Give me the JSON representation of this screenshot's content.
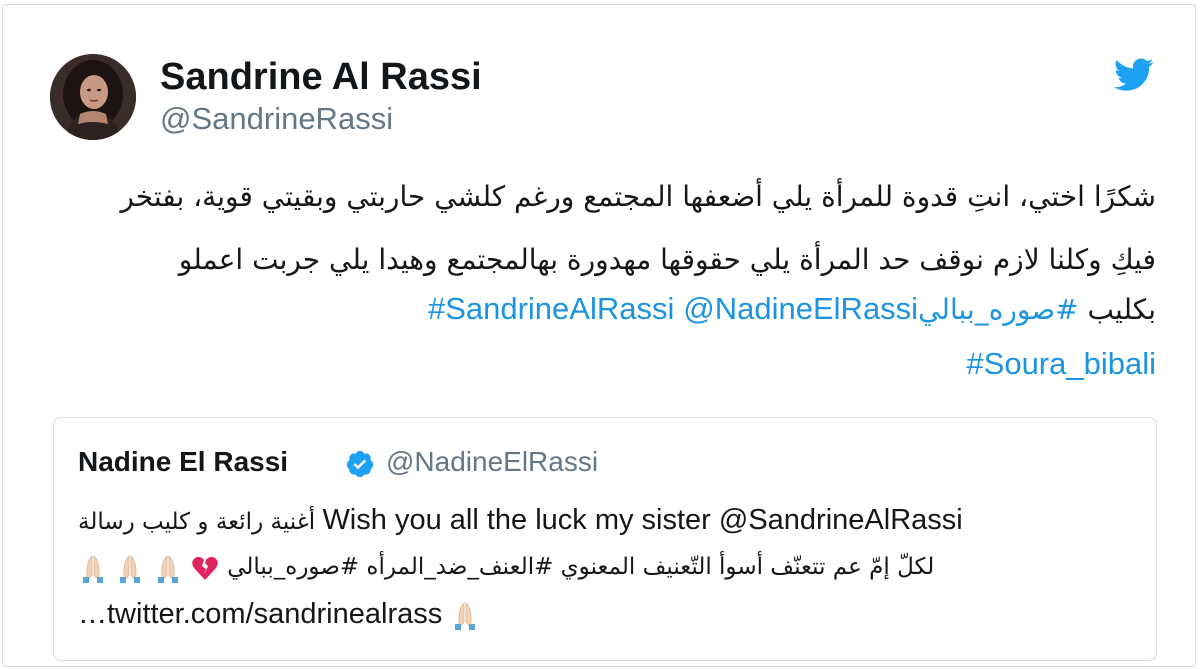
{
  "author": {
    "display_name": "Sandrine Al Rassi",
    "handle": "@SandrineRassi"
  },
  "icons": {
    "avatar": "profile-photo",
    "brand": "twitter-bird-icon",
    "verified": "verified-badge-icon",
    "emoji_prayer": "folded-hands-emoji",
    "emoji_heart": "broken-heart-emoji"
  },
  "colors": {
    "link": "#1c94e0",
    "muted": "#657786",
    "text": "#14171a",
    "twitter_blue": "#1da1f2",
    "heart": "#e0245e"
  },
  "tweet": {
    "line1": "شكرًا اختي، انتِ قدوة للمرأة يلي أضعفها المجتمع ورغم كلشي حاربتي وبقيتي قوية، بفتخر",
    "line2": "فيكِ وكلنا لازم نوقف حد المرأة يلي حقوقها مهدورة بهالمجتمع وهيدا يلي جربت اعملو",
    "line3_prefix": "بكليب ",
    "hashtag_soura_ar": "#صوره_ببالي",
    "mention_nadine": "@NadineElRassi",
    "hashtag_sandrine": "#SandrineAlRassi",
    "hashtag_soura_en": "#Soura_bibali"
  },
  "quoted": {
    "display_name": "Nadine El Rassi",
    "handle": "@NadineElRassi",
    "line1_latin": "Wish you all the luck my sister @SandrineAlRassi",
    "line1_arabic": "أغنية رائعة و كليب رسالة",
    "line2_arabic": "لكلّ إمّ عم تتعنّف أسوأ التّعنيف المعنوي #العنف_ضد_المرأه #صوره_ببالي",
    "line3_link": "…twitter.com/sandrinealrass"
  }
}
